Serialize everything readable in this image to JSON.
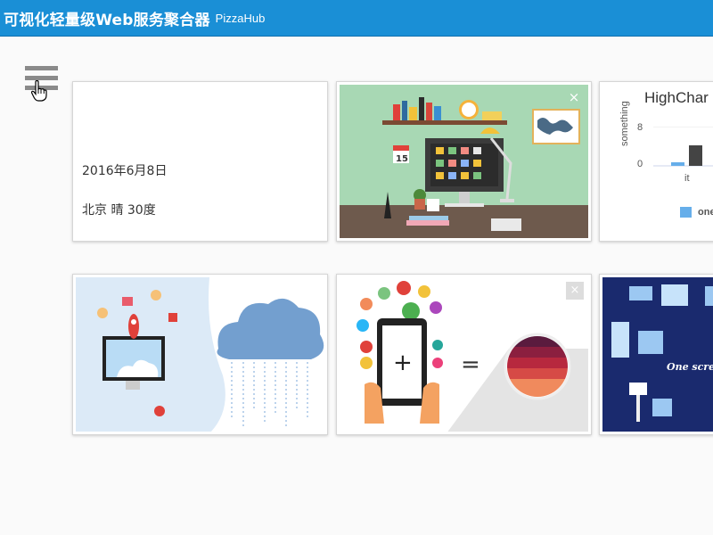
{
  "header": {
    "title": "可视化轻量级Web服务聚合器",
    "subtitle": "PizzaHub"
  },
  "menu": {
    "icon": "hamburger-menu-icon"
  },
  "cards": {
    "weather": {
      "date": "2016年6月8日",
      "city_weather": "北京 晴 30度"
    },
    "highchart": {
      "title": "HighChar",
      "ylabel": "something",
      "yticks": [
        "8",
        "0"
      ],
      "xticks": [
        "it"
      ],
      "legend": "one"
    },
    "close_label": "×"
  },
  "colors": {
    "header": "#1a8fd6",
    "bar_blue": "#66aeea",
    "bar_dark": "#444444"
  }
}
